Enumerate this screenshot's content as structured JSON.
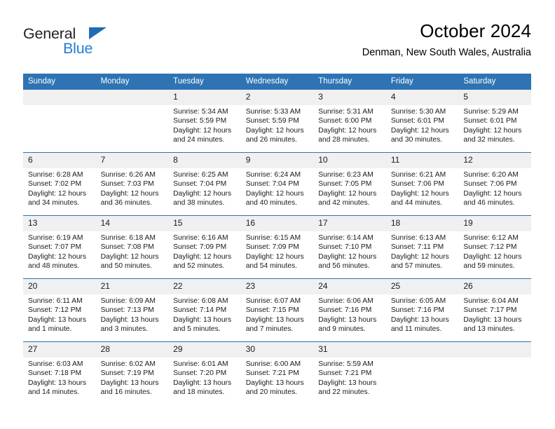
{
  "brand": {
    "name_primary": "General",
    "name_secondary": "Blue",
    "triangle_color": "#1f6cb4",
    "secondary_color": "#1f7fd4"
  },
  "header": {
    "title": "October 2024",
    "subtitle": "Denman, New South Wales, Australia"
  },
  "theme": {
    "header_bg": "#2e74b5",
    "header_text": "#ffffff",
    "daynum_bg": "#f0f0f0",
    "cell_bg": "#ffffff",
    "row_border": "#2e74b5"
  },
  "weekday_headers": [
    "Sunday",
    "Monday",
    "Tuesday",
    "Wednesday",
    "Thursday",
    "Friday",
    "Saturday"
  ],
  "labels": {
    "sunrise_prefix": "Sunrise:",
    "sunset_prefix": "Sunset:",
    "daylight_prefix": "Daylight:"
  },
  "weeks": [
    [
      {
        "day": "",
        "sunrise": "",
        "sunset": "",
        "daylight_line1": "",
        "daylight_line2": ""
      },
      {
        "day": "",
        "sunrise": "",
        "sunset": "",
        "daylight_line1": "",
        "daylight_line2": ""
      },
      {
        "day": "1",
        "sunrise": "Sunrise: 5:34 AM",
        "sunset": "Sunset: 5:59 PM",
        "daylight_line1": "Daylight: 12 hours",
        "daylight_line2": "and 24 minutes."
      },
      {
        "day": "2",
        "sunrise": "Sunrise: 5:33 AM",
        "sunset": "Sunset: 5:59 PM",
        "daylight_line1": "Daylight: 12 hours",
        "daylight_line2": "and 26 minutes."
      },
      {
        "day": "3",
        "sunrise": "Sunrise: 5:31 AM",
        "sunset": "Sunset: 6:00 PM",
        "daylight_line1": "Daylight: 12 hours",
        "daylight_line2": "and 28 minutes."
      },
      {
        "day": "4",
        "sunrise": "Sunrise: 5:30 AM",
        "sunset": "Sunset: 6:01 PM",
        "daylight_line1": "Daylight: 12 hours",
        "daylight_line2": "and 30 minutes."
      },
      {
        "day": "5",
        "sunrise": "Sunrise: 5:29 AM",
        "sunset": "Sunset: 6:01 PM",
        "daylight_line1": "Daylight: 12 hours",
        "daylight_line2": "and 32 minutes."
      }
    ],
    [
      {
        "day": "6",
        "sunrise": "Sunrise: 6:28 AM",
        "sunset": "Sunset: 7:02 PM",
        "daylight_line1": "Daylight: 12 hours",
        "daylight_line2": "and 34 minutes."
      },
      {
        "day": "7",
        "sunrise": "Sunrise: 6:26 AM",
        "sunset": "Sunset: 7:03 PM",
        "daylight_line1": "Daylight: 12 hours",
        "daylight_line2": "and 36 minutes."
      },
      {
        "day": "8",
        "sunrise": "Sunrise: 6:25 AM",
        "sunset": "Sunset: 7:04 PM",
        "daylight_line1": "Daylight: 12 hours",
        "daylight_line2": "and 38 minutes."
      },
      {
        "day": "9",
        "sunrise": "Sunrise: 6:24 AM",
        "sunset": "Sunset: 7:04 PM",
        "daylight_line1": "Daylight: 12 hours",
        "daylight_line2": "and 40 minutes."
      },
      {
        "day": "10",
        "sunrise": "Sunrise: 6:23 AM",
        "sunset": "Sunset: 7:05 PM",
        "daylight_line1": "Daylight: 12 hours",
        "daylight_line2": "and 42 minutes."
      },
      {
        "day": "11",
        "sunrise": "Sunrise: 6:21 AM",
        "sunset": "Sunset: 7:06 PM",
        "daylight_line1": "Daylight: 12 hours",
        "daylight_line2": "and 44 minutes."
      },
      {
        "day": "12",
        "sunrise": "Sunrise: 6:20 AM",
        "sunset": "Sunset: 7:06 PM",
        "daylight_line1": "Daylight: 12 hours",
        "daylight_line2": "and 46 minutes."
      }
    ],
    [
      {
        "day": "13",
        "sunrise": "Sunrise: 6:19 AM",
        "sunset": "Sunset: 7:07 PM",
        "daylight_line1": "Daylight: 12 hours",
        "daylight_line2": "and 48 minutes."
      },
      {
        "day": "14",
        "sunrise": "Sunrise: 6:18 AM",
        "sunset": "Sunset: 7:08 PM",
        "daylight_line1": "Daylight: 12 hours",
        "daylight_line2": "and 50 minutes."
      },
      {
        "day": "15",
        "sunrise": "Sunrise: 6:16 AM",
        "sunset": "Sunset: 7:09 PM",
        "daylight_line1": "Daylight: 12 hours",
        "daylight_line2": "and 52 minutes."
      },
      {
        "day": "16",
        "sunrise": "Sunrise: 6:15 AM",
        "sunset": "Sunset: 7:09 PM",
        "daylight_line1": "Daylight: 12 hours",
        "daylight_line2": "and 54 minutes."
      },
      {
        "day": "17",
        "sunrise": "Sunrise: 6:14 AM",
        "sunset": "Sunset: 7:10 PM",
        "daylight_line1": "Daylight: 12 hours",
        "daylight_line2": "and 56 minutes."
      },
      {
        "day": "18",
        "sunrise": "Sunrise: 6:13 AM",
        "sunset": "Sunset: 7:11 PM",
        "daylight_line1": "Daylight: 12 hours",
        "daylight_line2": "and 57 minutes."
      },
      {
        "day": "19",
        "sunrise": "Sunrise: 6:12 AM",
        "sunset": "Sunset: 7:12 PM",
        "daylight_line1": "Daylight: 12 hours",
        "daylight_line2": "and 59 minutes."
      }
    ],
    [
      {
        "day": "20",
        "sunrise": "Sunrise: 6:11 AM",
        "sunset": "Sunset: 7:12 PM",
        "daylight_line1": "Daylight: 13 hours",
        "daylight_line2": "and 1 minute."
      },
      {
        "day": "21",
        "sunrise": "Sunrise: 6:09 AM",
        "sunset": "Sunset: 7:13 PM",
        "daylight_line1": "Daylight: 13 hours",
        "daylight_line2": "and 3 minutes."
      },
      {
        "day": "22",
        "sunrise": "Sunrise: 6:08 AM",
        "sunset": "Sunset: 7:14 PM",
        "daylight_line1": "Daylight: 13 hours",
        "daylight_line2": "and 5 minutes."
      },
      {
        "day": "23",
        "sunrise": "Sunrise: 6:07 AM",
        "sunset": "Sunset: 7:15 PM",
        "daylight_line1": "Daylight: 13 hours",
        "daylight_line2": "and 7 minutes."
      },
      {
        "day": "24",
        "sunrise": "Sunrise: 6:06 AM",
        "sunset": "Sunset: 7:16 PM",
        "daylight_line1": "Daylight: 13 hours",
        "daylight_line2": "and 9 minutes."
      },
      {
        "day": "25",
        "sunrise": "Sunrise: 6:05 AM",
        "sunset": "Sunset: 7:16 PM",
        "daylight_line1": "Daylight: 13 hours",
        "daylight_line2": "and 11 minutes."
      },
      {
        "day": "26",
        "sunrise": "Sunrise: 6:04 AM",
        "sunset": "Sunset: 7:17 PM",
        "daylight_line1": "Daylight: 13 hours",
        "daylight_line2": "and 13 minutes."
      }
    ],
    [
      {
        "day": "27",
        "sunrise": "Sunrise: 6:03 AM",
        "sunset": "Sunset: 7:18 PM",
        "daylight_line1": "Daylight: 13 hours",
        "daylight_line2": "and 14 minutes."
      },
      {
        "day": "28",
        "sunrise": "Sunrise: 6:02 AM",
        "sunset": "Sunset: 7:19 PM",
        "daylight_line1": "Daylight: 13 hours",
        "daylight_line2": "and 16 minutes."
      },
      {
        "day": "29",
        "sunrise": "Sunrise: 6:01 AM",
        "sunset": "Sunset: 7:20 PM",
        "daylight_line1": "Daylight: 13 hours",
        "daylight_line2": "and 18 minutes."
      },
      {
        "day": "30",
        "sunrise": "Sunrise: 6:00 AM",
        "sunset": "Sunset: 7:21 PM",
        "daylight_line1": "Daylight: 13 hours",
        "daylight_line2": "and 20 minutes."
      },
      {
        "day": "31",
        "sunrise": "Sunrise: 5:59 AM",
        "sunset": "Sunset: 7:21 PM",
        "daylight_line1": "Daylight: 13 hours",
        "daylight_line2": "and 22 minutes."
      },
      {
        "day": "",
        "sunrise": "",
        "sunset": "",
        "daylight_line1": "",
        "daylight_line2": ""
      },
      {
        "day": "",
        "sunrise": "",
        "sunset": "",
        "daylight_line1": "",
        "daylight_line2": ""
      }
    ]
  ]
}
